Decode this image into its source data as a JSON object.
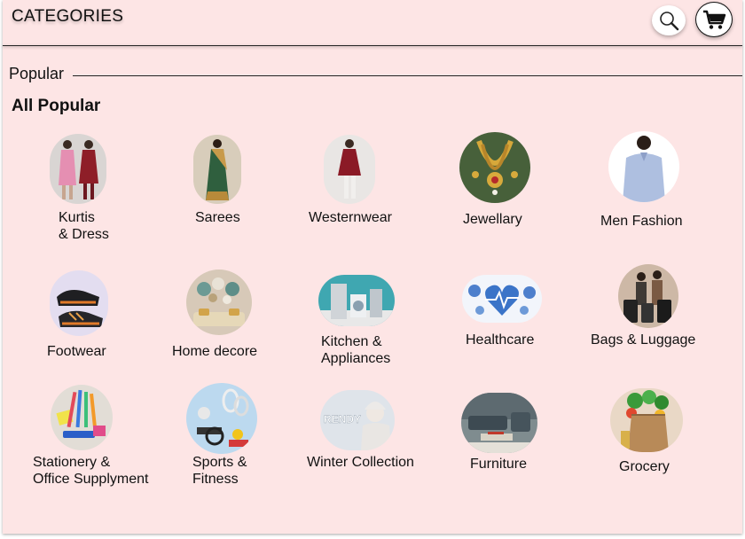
{
  "header": {
    "title": "CATEGORIES",
    "search_icon": "search-icon",
    "cart_icon": "cart-icon"
  },
  "section": {
    "label": "Popular",
    "subheading": "All Popular"
  },
  "categories": [
    {
      "line1": "Kurtis",
      "line2": "& Dress"
    },
    {
      "line1": "Sarees",
      "line2": ""
    },
    {
      "line1": "Westernwear",
      "line2": ""
    },
    {
      "line1": "Jewellary",
      "line2": ""
    },
    {
      "line1": "Men Fashion",
      "line2": ""
    },
    {
      "line1": "Footwear",
      "line2": ""
    },
    {
      "line1": "Home decore",
      "line2": ""
    },
    {
      "line1": "Kitchen &",
      "line2": "Appliances"
    },
    {
      "line1": "Healthcare",
      "line2": ""
    },
    {
      "line1": "Bags & Luggage",
      "line2": ""
    },
    {
      "line1": "Stationery &",
      "line2": "Office Supplyment"
    },
    {
      "line1": "Sports &",
      "line2": "Fitness"
    },
    {
      "line1": "Winter Collection",
      "line2": ""
    },
    {
      "line1": "Furniture",
      "line2": ""
    },
    {
      "line1": "Grocery",
      "line2": ""
    }
  ],
  "image_texts": {
    "winter_banner": "RENDY"
  }
}
